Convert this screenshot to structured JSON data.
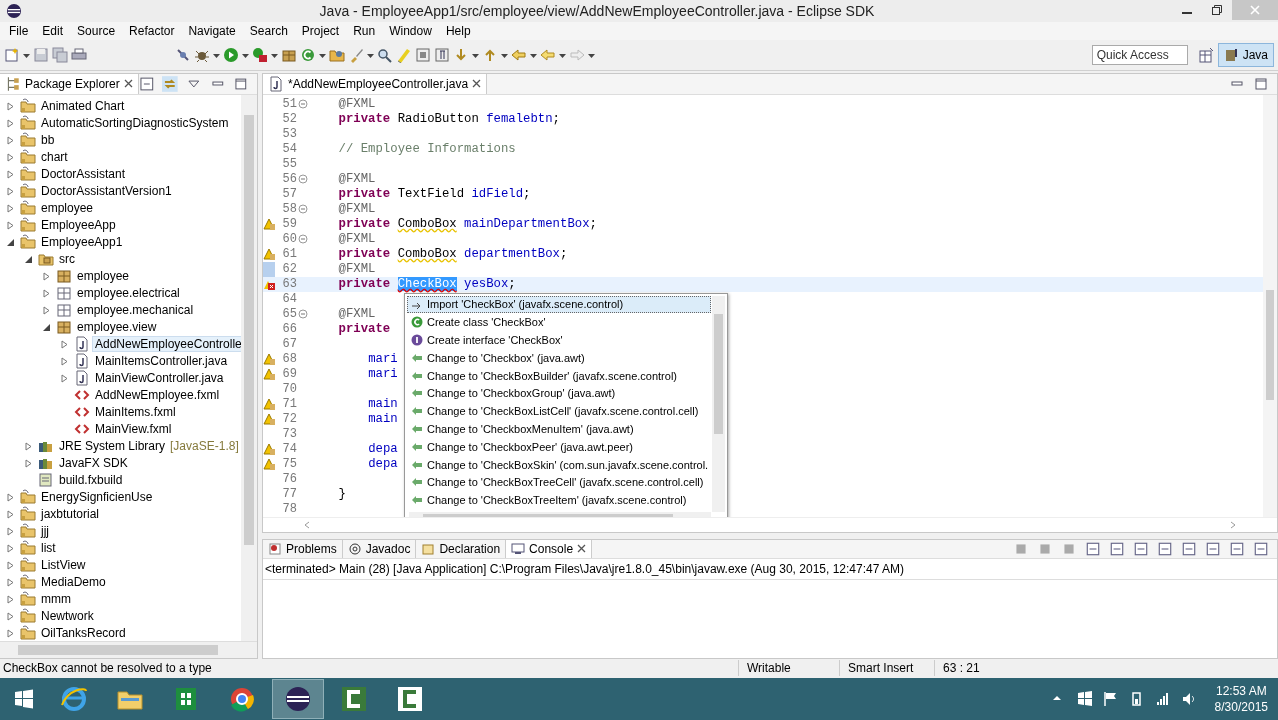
{
  "window": {
    "title": "Java - EmployeeApp1/src/employee/view/AddNewEmployeeController.java - Eclipse SDK"
  },
  "menu": [
    "File",
    "Edit",
    "Source",
    "Refactor",
    "Navigate",
    "Search",
    "Project",
    "Run",
    "Window",
    "Help"
  ],
  "toolbar": {
    "quick_access": {
      "placeholder": "Quick Access"
    },
    "perspectives": [
      {
        "label": "Java",
        "selected": true
      }
    ]
  },
  "package_explorer": {
    "title": "Package Explorer",
    "tree": [
      {
        "label": "Animated Chart",
        "kind": "project",
        "expanded": false,
        "selected": false
      },
      {
        "label": "AutomaticSortingDiagnosticSystem",
        "kind": "project",
        "expanded": false,
        "selected": false
      },
      {
        "label": "bb",
        "kind": "project",
        "expanded": false,
        "selected": false
      },
      {
        "label": "chart",
        "kind": "project",
        "expanded": false,
        "selected": false
      },
      {
        "label": "DoctorAssistant",
        "kind": "project",
        "expanded": false,
        "selected": false
      },
      {
        "label": "DoctorAssistantVersion1",
        "kind": "project",
        "expanded": false,
        "selected": false
      },
      {
        "label": "employee",
        "kind": "project",
        "expanded": false,
        "selected": false
      },
      {
        "label": "EmployeeApp",
        "kind": "project",
        "expanded": false,
        "selected": false
      },
      {
        "label": "EmployeeApp1",
        "kind": "project",
        "expanded": true,
        "selected": false,
        "children": [
          {
            "label": "src",
            "kind": "source",
            "expanded": true,
            "selected": false,
            "children": [
              {
                "label": "employee",
                "kind": "package",
                "expanded": false,
                "selected": false
              },
              {
                "label": "employee.electrical",
                "kind": "empty-package",
                "expanded": false,
                "selected": false
              },
              {
                "label": "employee.mechanical",
                "kind": "empty-package",
                "expanded": false,
                "selected": false
              },
              {
                "label": "employee.view",
                "kind": "package",
                "expanded": true,
                "selected": false,
                "children": [
                  {
                    "label": "AddNewEmployeeControlle",
                    "kind": "java",
                    "expanded": false,
                    "selected": true
                  },
                  {
                    "label": "MainItemsController.java",
                    "kind": "java",
                    "expanded": false,
                    "selected": false
                  },
                  {
                    "label": "MainViewController.java",
                    "kind": "java",
                    "expanded": false,
                    "selected": false
                  },
                  {
                    "label": "AddNewEmployee.fxml",
                    "kind": "fxml",
                    "selected": false
                  },
                  {
                    "label": "MainItems.fxml",
                    "kind": "fxml",
                    "selected": false
                  },
                  {
                    "label": "MainView.fxml",
                    "kind": "fxml",
                    "selected": false
                  }
                ]
              }
            ]
          },
          {
            "label": "JRE System Library",
            "suffix": "[JavaSE-1.8]",
            "kind": "library",
            "expanded": false,
            "selected": false
          },
          {
            "label": "JavaFX SDK",
            "kind": "library",
            "expanded": false,
            "selected": false
          },
          {
            "label": "build.fxbuild",
            "kind": "file",
            "selected": false
          }
        ]
      },
      {
        "label": "EnergySignficienUse",
        "kind": "project",
        "expanded": false,
        "selected": false
      },
      {
        "label": "jaxbtutorial",
        "kind": "project",
        "expanded": false,
        "selected": false
      },
      {
        "label": "jjj",
        "kind": "project",
        "expanded": false,
        "selected": false
      },
      {
        "label": "list",
        "kind": "project",
        "expanded": false,
        "selected": false
      },
      {
        "label": "ListView",
        "kind": "project",
        "expanded": false,
        "selected": false
      },
      {
        "label": "MediaDemo",
        "kind": "project",
        "expanded": false,
        "selected": false
      },
      {
        "label": "mmm",
        "kind": "project",
        "expanded": false,
        "selected": false
      },
      {
        "label": "Newtwork",
        "kind": "project",
        "expanded": false,
        "selected": false
      },
      {
        "label": "OilTanksRecord",
        "kind": "project",
        "expanded": false,
        "selected": false
      }
    ]
  },
  "editor": {
    "tab": "*AddNewEmployeeController.java",
    "lines": [
      {
        "number": "51",
        "fold": true,
        "current": false,
        "warning": false,
        "error": false,
        "occurrence": false,
        "kind": "member",
        "tokens": [
          {
            "kind": "annotation",
            "text": "@FXML"
          }
        ]
      },
      {
        "number": "52",
        "fold": false,
        "current": false,
        "warning": false,
        "error": false,
        "occurrence": false,
        "kind": "member",
        "tokens": [
          {
            "kind": "keyword",
            "text": "private"
          },
          {
            "kind": "plain",
            "text": " RadioButton "
          },
          {
            "kind": "field",
            "text": "femalebtn"
          },
          {
            "kind": "plain",
            "text": ";"
          }
        ]
      },
      {
        "number": "53",
        "fold": false,
        "current": false,
        "warning": false,
        "error": false,
        "occurrence": false
      },
      {
        "number": "54",
        "fold": false,
        "current": false,
        "warning": false,
        "error": false,
        "occurrence": false,
        "kind": "member",
        "tokens": [
          {
            "kind": "comment",
            "text": "// Employee Informations"
          }
        ]
      },
      {
        "number": "55",
        "fold": false,
        "current": false,
        "warning": false,
        "error": false,
        "occurrence": false
      },
      {
        "number": "56",
        "fold": true,
        "current": false,
        "warning": false,
        "error": false,
        "occurrence": false,
        "kind": "member",
        "tokens": [
          {
            "kind": "annotation",
            "text": "@FXML"
          }
        ]
      },
      {
        "number": "57",
        "fold": false,
        "current": false,
        "warning": false,
        "error": false,
        "occurrence": false,
        "kind": "member",
        "tokens": [
          {
            "kind": "keyword",
            "text": "private"
          },
          {
            "kind": "plain",
            "text": " TextField "
          },
          {
            "kind": "field",
            "text": "idField"
          },
          {
            "kind": "plain",
            "text": ";"
          }
        ]
      },
      {
        "number": "58",
        "fold": true,
        "current": false,
        "warning": false,
        "error": false,
        "occurrence": false,
        "kind": "member",
        "tokens": [
          {
            "kind": "annotation",
            "text": "@FXML"
          }
        ]
      },
      {
        "number": "59",
        "fold": false,
        "current": false,
        "warning": true,
        "error": false,
        "occurrence": false,
        "kind": "member",
        "tokens": [
          {
            "kind": "keyword",
            "text": "private "
          },
          {
            "kind": "warning",
            "text": "ComboBox"
          },
          {
            "kind": "field",
            "text": " mainDepartmentBox"
          },
          {
            "kind": "plain",
            "text": ";"
          }
        ]
      },
      {
        "number": "60",
        "fold": true,
        "current": false,
        "warning": false,
        "error": false,
        "occurrence": false,
        "kind": "member",
        "tokens": [
          {
            "kind": "annotation",
            "text": "@FXML"
          }
        ]
      },
      {
        "number": "61",
        "fold": false,
        "current": false,
        "warning": true,
        "error": false,
        "occurrence": false,
        "kind": "member",
        "tokens": [
          {
            "kind": "keyword",
            "text": "private "
          },
          {
            "kind": "warning",
            "text": "ComboBox"
          },
          {
            "kind": "field",
            "text": " departmentBox"
          },
          {
            "kind": "plain",
            "text": ";"
          }
        ]
      },
      {
        "number": "62",
        "fold": false,
        "current": false,
        "warning": false,
        "error": false,
        "occurrence": true,
        "kind": "member",
        "tokens": [
          {
            "kind": "annotation",
            "text": "@FXML"
          }
        ]
      },
      {
        "number": "63",
        "fold": false,
        "current": true,
        "warning": false,
        "error": true,
        "occurrence": false,
        "kind": "member",
        "tokens": [
          {
            "kind": "keyword",
            "text": "private "
          },
          {
            "kind": "error",
            "text": "CheckBox",
            "selected": true
          },
          {
            "kind": "field",
            "text": " yesBox"
          },
          {
            "kind": "plain",
            "text": ";"
          }
        ]
      },
      {
        "number": "64",
        "fold": false,
        "current": false,
        "warning": false,
        "error": false,
        "occurrence": false
      },
      {
        "number": "65",
        "fold": true,
        "current": false,
        "warning": false,
        "error": false,
        "occurrence": false,
        "kind": "member",
        "tokens": [
          {
            "kind": "annotation",
            "text": "@FXML"
          }
        ]
      },
      {
        "number": "66",
        "fold": false,
        "current": false,
        "warning": false,
        "error": false,
        "occurrence": false,
        "kind": "member",
        "tokens": [
          {
            "kind": "keyword",
            "text": "private"
          }
        ]
      },
      {
        "number": "67",
        "fold": false,
        "current": false,
        "warning": false,
        "error": false,
        "occurrence": false
      },
      {
        "number": "68",
        "fold": false,
        "current": false,
        "warning": true,
        "error": false,
        "occurrence": false,
        "kind": "statement",
        "tokens": [
          {
            "kind": "field",
            "text": "mari"
          }
        ]
      },
      {
        "number": "69",
        "fold": false,
        "current": false,
        "warning": true,
        "error": false,
        "occurrence": false,
        "kind": "statement",
        "tokens": [
          {
            "kind": "field",
            "text": "mari"
          }
        ]
      },
      {
        "number": "70",
        "fold": false,
        "current": false,
        "warning": false,
        "error": false,
        "occurrence": false
      },
      {
        "number": "71",
        "fold": false,
        "current": false,
        "warning": true,
        "error": false,
        "occurrence": false,
        "kind": "statement",
        "tokens": [
          {
            "kind": "field",
            "text": "main"
          }
        ]
      },
      {
        "number": "72",
        "fold": false,
        "current": false,
        "warning": true,
        "error": false,
        "occurrence": false,
        "kind": "statement",
        "tokens": [
          {
            "kind": "field",
            "text": "main"
          }
        ]
      },
      {
        "number": "73",
        "fold": false,
        "current": false,
        "warning": false,
        "error": false,
        "occurrence": false
      },
      {
        "number": "74",
        "fold": false,
        "current": false,
        "warning": true,
        "error": false,
        "occurrence": false,
        "kind": "statement",
        "tokens": [
          {
            "kind": "field",
            "text": "depa"
          }
        ]
      },
      {
        "number": "75",
        "fold": false,
        "current": false,
        "warning": true,
        "error": false,
        "occurrence": false,
        "kind": "statement",
        "tokens": [
          {
            "kind": "field",
            "text": "depa"
          }
        ]
      },
      {
        "number": "76",
        "fold": false,
        "current": false,
        "warning": false,
        "error": false,
        "occurrence": false
      },
      {
        "number": "77",
        "fold": false,
        "current": false,
        "warning": false,
        "error": false,
        "occurrence": false,
        "kind": "member",
        "tokens": [
          {
            "kind": "plain",
            "text": "}"
          }
        ]
      },
      {
        "number": "78",
        "fold": false,
        "current": false,
        "warning": false,
        "error": false,
        "occurrence": false
      }
    ]
  },
  "quick_fix": {
    "items": [
      {
        "label": "Import 'CheckBox' (javafx.scene.control)",
        "kind": "import",
        "selected": true
      },
      {
        "label": "Create class 'CheckBox'",
        "kind": "class",
        "selected": false
      },
      {
        "label": "Create interface 'CheckBox'",
        "kind": "interface",
        "selected": false
      },
      {
        "label": "Change to 'Checkbox' (java.awt)",
        "kind": "change",
        "selected": false
      },
      {
        "label": "Change to 'CheckBoxBuilder' (javafx.scene.control)",
        "kind": "change",
        "selected": false
      },
      {
        "label": "Change to 'CheckboxGroup' (java.awt)",
        "kind": "change",
        "selected": false
      },
      {
        "label": "Change to 'CheckBoxListCell' (javafx.scene.control.cell)",
        "kind": "change",
        "selected": false
      },
      {
        "label": "Change to 'CheckboxMenuItem' (java.awt)",
        "kind": "change",
        "selected": false
      },
      {
        "label": "Change to 'CheckboxPeer' (java.awt.peer)",
        "kind": "change",
        "selected": false
      },
      {
        "label": "Change to 'CheckBoxSkin' (com.sun.javafx.scene.control.",
        "kind": "change",
        "selected": false
      },
      {
        "label": "Change to 'CheckBoxTreeCell' (javafx.scene.control.cell)",
        "kind": "change",
        "selected": false
      },
      {
        "label": "Change to 'CheckBoxTreeItem' (javafx.scene.control)",
        "kind": "change",
        "selected": false
      }
    ]
  },
  "bottom_panel": {
    "tabs": [
      {
        "label": "Problems",
        "kind": "problems",
        "selected": false
      },
      {
        "label": "Javadoc",
        "kind": "javadoc",
        "selected": false
      },
      {
        "label": "Declaration",
        "kind": "declaration",
        "selected": false
      },
      {
        "label": "Console",
        "kind": "console",
        "selected": true
      }
    ],
    "console_header": "<terminated> Main (28) [Java Application] C:\\Program Files\\Java\\jre1.8.0_45\\bin\\javaw.exe (Aug 30, 2015, 12:47:47 AM)"
  },
  "status_bar": {
    "message": "CheckBox cannot be resolved to a type",
    "mode": "Writable",
    "insert": "Smart Insert",
    "position": "63 : 21"
  },
  "taskbar": {
    "apps": [
      {
        "kind": "ie",
        "selected": false
      },
      {
        "kind": "explorer",
        "selected": false
      },
      {
        "kind": "sheet",
        "selected": false
      },
      {
        "kind": "chrome",
        "selected": false
      },
      {
        "kind": "eclipse",
        "selected": true
      },
      {
        "kind": "camtasia",
        "selected": false
      },
      {
        "kind": "camtasia-light",
        "selected": false
      }
    ],
    "time": "12:53 AM",
    "date": "8/30/2015"
  }
}
